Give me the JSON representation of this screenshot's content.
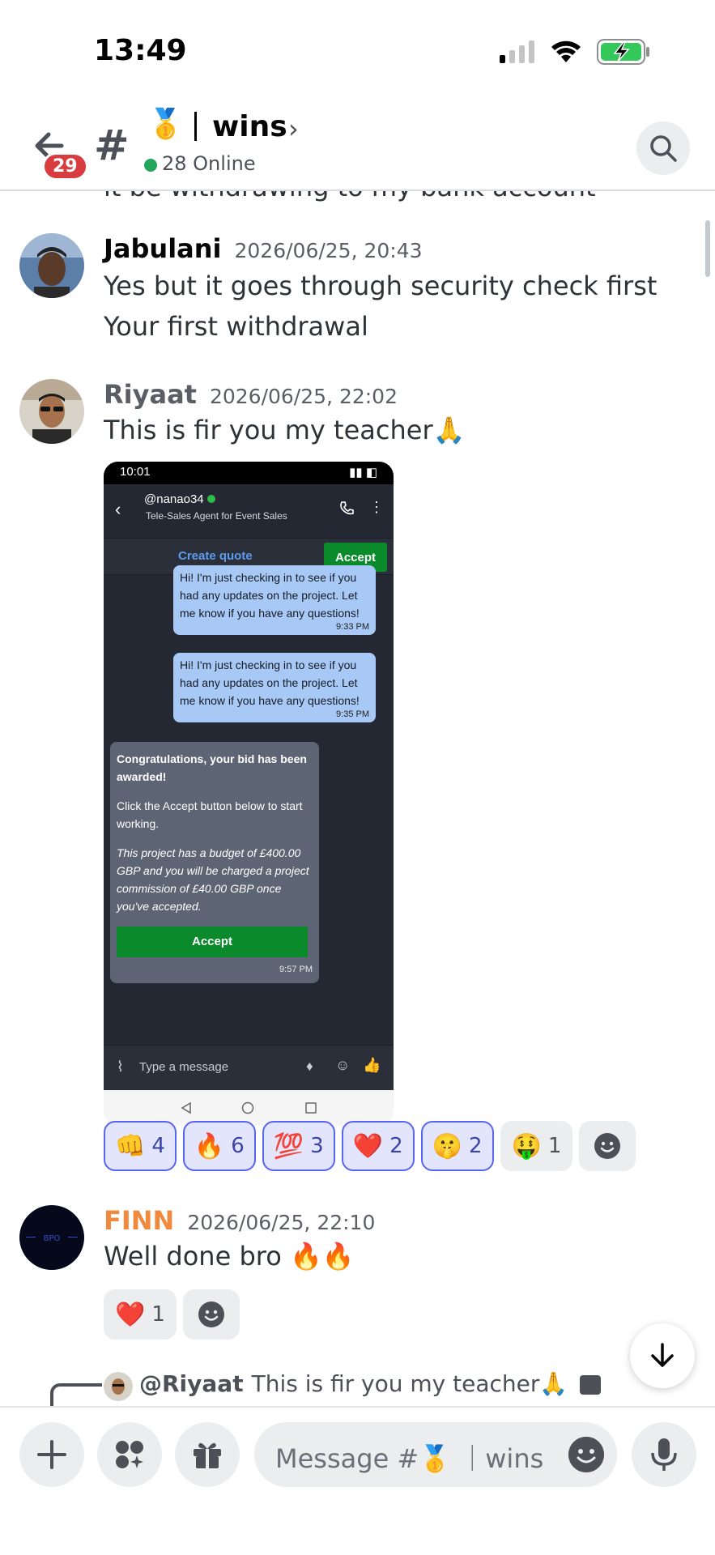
{
  "status_bar": {
    "time": "13:49"
  },
  "header": {
    "unread_count": "29",
    "channel_emoji": "🥇",
    "channel_name": "wins",
    "online": "28 Online"
  },
  "cut_message": "it be withdrawing to my bank account",
  "messages": [
    {
      "author": "Jabulani",
      "author_color": "#060607",
      "timestamp": "2026/06/25, 20:43",
      "lines": [
        "Yes but it goes through security check first",
        "Your first withdrawal"
      ]
    },
    {
      "author": "Riyaat",
      "author_color": "#5c5e66",
      "timestamp": "2026/06/25, 22:02",
      "lines": [
        "This is fir you my teacher🙏"
      ],
      "attachment": {
        "status_time": "10:01",
        "user": "@nanao34",
        "role": "Tele-Sales Agent for Event Sales",
        "create_quote": "Create quote",
        "accept_top": "Accept",
        "bubbles": [
          {
            "text": "Hi! I'm just checking in to see if you had any updates on the project. Let me know if you have any questions!",
            "time": "9:33 PM"
          },
          {
            "text": "Hi! I'm just checking in to see if you had any updates on the project. Let me know if you have any questions!",
            "time": "9:35 PM"
          }
        ],
        "award_title": "Congratulations, your bid has been awarded!",
        "award_line": "Click the Accept button below to start working.",
        "award_budget": "This project has a budget of £400.00 GBP and you will be charged a project commission of £40.00 GBP once you've accepted.",
        "award_accept": "Accept",
        "award_time": "9:57 PM",
        "input_placeholder": "Type a message"
      },
      "reactions": [
        {
          "emoji": "👊",
          "count": "4",
          "active": true
        },
        {
          "emoji": "🔥",
          "count": "6",
          "active": true
        },
        {
          "emoji": "💯",
          "count": "3",
          "active": true
        },
        {
          "emoji": "❤️",
          "count": "2",
          "active": true
        },
        {
          "emoji": "🤫",
          "count": "2",
          "active": true
        },
        {
          "emoji": "🤑",
          "count": "1",
          "active": false
        }
      ]
    },
    {
      "author": "FINN",
      "author_color": "#f0883e",
      "timestamp": "2026/06/25, 22:10",
      "lines": [
        "Well done bro 🔥🔥"
      ],
      "reactions": [
        {
          "emoji": "❤️",
          "count": "1",
          "active": false
        }
      ]
    }
  ],
  "reply_preview": {
    "mention": "@Riyaat",
    "text": "This is fir you my teacher🙏"
  },
  "composer": {
    "placeholder": "Message #🥇 ｜wins"
  }
}
